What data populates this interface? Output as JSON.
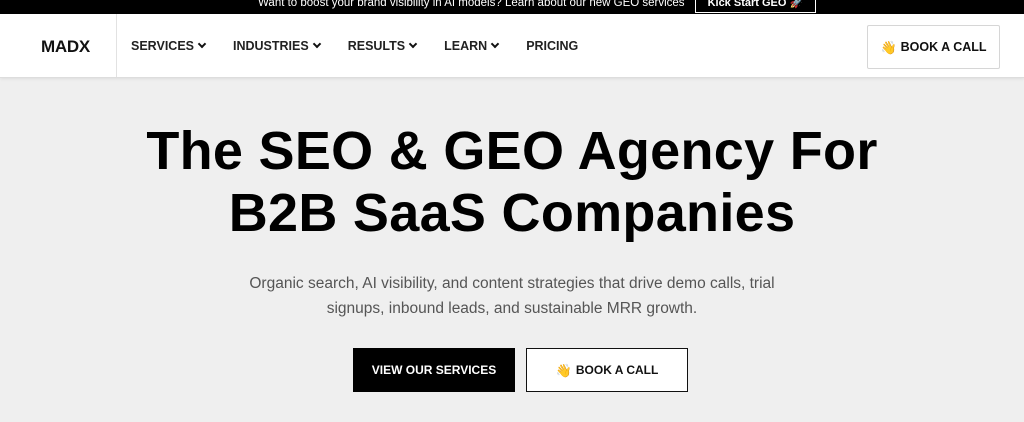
{
  "announcement": {
    "text": "Want to boost your brand visibility in AI models? Learn about our new GEO services",
    "cta_label": "Kick Start GEO 🚀"
  },
  "header": {
    "logo": "MADX",
    "nav": [
      {
        "label": "SERVICES",
        "has_dropdown": true
      },
      {
        "label": "INDUSTRIES",
        "has_dropdown": true
      },
      {
        "label": "RESULTS",
        "has_dropdown": true
      },
      {
        "label": "LEARN",
        "has_dropdown": true
      },
      {
        "label": "PRICING",
        "has_dropdown": false
      }
    ],
    "cta_icon": "👋",
    "cta_label": "BOOK A CALL"
  },
  "hero": {
    "title_line1": "The SEO & GEO Agency For",
    "title_line2": "B2B SaaS Companies",
    "subtitle_line1": "Organic search, AI visibility, and content strategies that drive demo calls, trial",
    "subtitle_line2": "signups, inbound leads, and sustainable MRR growth.",
    "primary_button": "VIEW OUR SERVICES",
    "secondary_button_icon": "👋",
    "secondary_button": "BOOK A CALL"
  },
  "colors": {
    "page_background": "#efefef",
    "header_background": "#ffffff",
    "announcement_background": "#000000",
    "primary_button": "#000000"
  }
}
